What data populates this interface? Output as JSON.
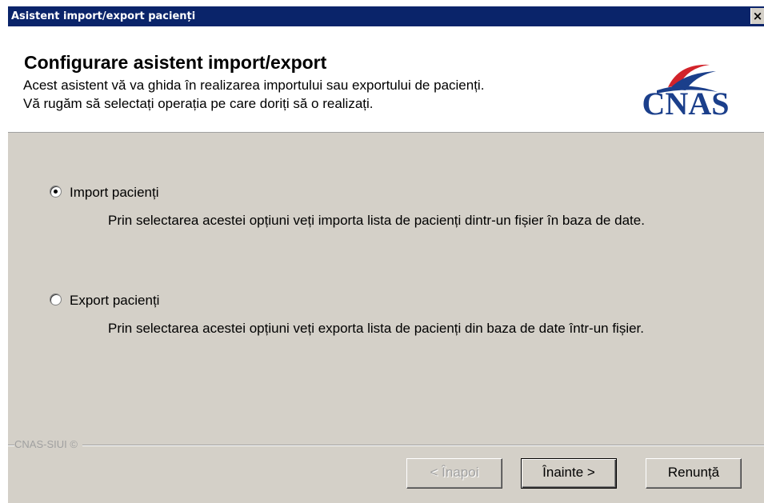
{
  "window": {
    "title": "Asistent import/export pacienți",
    "close_glyph": "×"
  },
  "header": {
    "title": "Configurare asistent import/export",
    "description_line1": "Acest asistent vă va ghida în realizarea importului sau exportului de pacienți.",
    "description_line2": "Vă rugăm să selectați operația pe care doriți să o realizați.",
    "logo_text": "CNAS",
    "logo_colors": {
      "text": "#1b3f8b",
      "swoosh_red": "#d2232a",
      "swoosh_blue": "#1b3f8b"
    }
  },
  "options": [
    {
      "label": "Import pacienți",
      "description": "Prin selectarea acestei opțiuni veți importa lista de pacienți dintr-un fișier în baza de date.",
      "selected": true
    },
    {
      "label": "Export pacienți",
      "description": "Prin selectarea acestei opțiuni veți exporta lista de pacienți din baza de date într-un fișier.",
      "selected": false
    }
  ],
  "footer": {
    "brand": "CNAS-SIUI ©",
    "back_label": "< Înapoi",
    "next_label": "Înainte >",
    "cancel_label": "Renunță"
  },
  "colors": {
    "titlebar": "#0a246a",
    "dialog_bg": "#d4d0c8"
  }
}
